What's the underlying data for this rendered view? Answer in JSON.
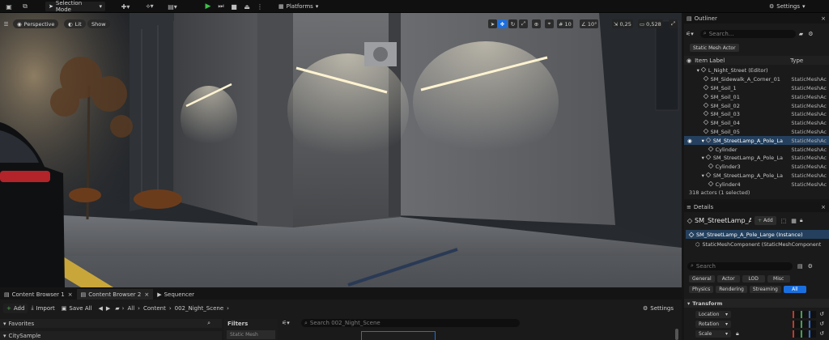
{
  "toolbar": {
    "selection_mode": "Selection Mode",
    "platforms": "Platforms",
    "settings": "Settings"
  },
  "viewport": {
    "perspective": "Perspective",
    "lit": "Lit",
    "show": "Show",
    "grid_snap": "10",
    "rot_snap": "10°",
    "scale_snap": "0,25",
    "cam_speed": "0,528"
  },
  "outliner": {
    "title": "Outliner",
    "search_placeholder": "Search...",
    "filter_chip": "Static Mesh Actor",
    "col_label": "Item Label",
    "col_type": "Type",
    "rows": [
      {
        "label": "L_Night_Street (Editor)",
        "type": "",
        "indent": 1
      },
      {
        "label": "SM_Sidewalk_A_Corner_01",
        "type": "StaticMeshAc",
        "indent": 2
      },
      {
        "label": "SM_Soil_1",
        "type": "StaticMeshAc",
        "indent": 2
      },
      {
        "label": "SM_Soil_01",
        "type": "StaticMeshAc",
        "indent": 2
      },
      {
        "label": "SM_Soil_02",
        "type": "StaticMeshAc",
        "indent": 2
      },
      {
        "label": "SM_Soil_03",
        "type": "StaticMeshAc",
        "indent": 2
      },
      {
        "label": "SM_Soil_04",
        "type": "StaticMeshAc",
        "indent": 2
      },
      {
        "label": "SM_Soil_05",
        "type": "StaticMeshAc",
        "indent": 2
      },
      {
        "label": "SM_StreetLamp_A_Pole_La",
        "type": "StaticMeshAc",
        "indent": 2,
        "selected": true
      },
      {
        "label": "Cylinder",
        "type": "StaticMeshAc",
        "indent": 3
      },
      {
        "label": "SM_StreetLamp_A_Pole_La",
        "type": "StaticMeshAc",
        "indent": 2
      },
      {
        "label": "Cylinder3",
        "type": "StaticMeshAc",
        "indent": 3
      },
      {
        "label": "SM_StreetLamp_A_Pole_La",
        "type": "StaticMeshAc",
        "indent": 2
      },
      {
        "label": "Cylinder4",
        "type": "StaticMeshAc",
        "indent": 3
      }
    ],
    "status": "318 actors (1 selected)"
  },
  "details": {
    "title": "Details",
    "object_name": "SM_StreetLamp_A_",
    "add": "Add",
    "instance": "SM_StreetLamp_A_Pole_Large (Instance)",
    "component": "StaticMeshComponent (StaticMeshComponent",
    "search_placeholder": "Search",
    "chips_row1": [
      "General",
      "Actor",
      "LOD",
      "Misc"
    ],
    "chips_row2": [
      "Physics",
      "Rendering",
      "Streaming",
      "All"
    ],
    "section": "Transform",
    "props": [
      "Location",
      "Rotation",
      "Scale"
    ]
  },
  "content": {
    "tabs": [
      "Content Browser 1",
      "Content Browser 2",
      "Sequencer"
    ],
    "add": "Add",
    "import": "Import",
    "save_all": "Save All",
    "path": [
      "All",
      "Content",
      "002_Night_Scene"
    ],
    "settings": "Settings",
    "favorites": "Favorites",
    "city_sample": "CitySample",
    "filters": "Filters",
    "filter_item": "Static Mesh",
    "search_placeholder": "Search 002_Night_Scene"
  },
  "colors": {
    "accent": "#1a6fe0",
    "selection_row": "#24405e",
    "play_green": "#3ec04a",
    "add_green": "#4caf50"
  }
}
